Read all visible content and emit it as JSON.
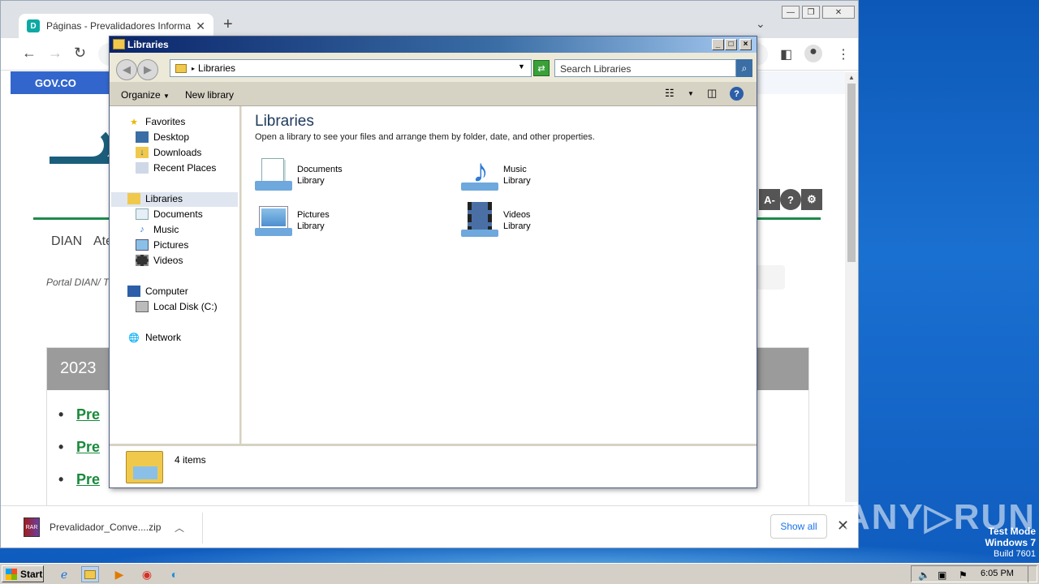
{
  "browser": {
    "tab_title": "Páginas - Prevalidadores Informació",
    "gov_label": "GOV.CO",
    "menu": [
      "DIAN",
      "Ate"
    ],
    "breadcrumb": "Portal DIAN/  T",
    "accessibility": [
      "A-",
      "?",
      "⚙"
    ],
    "panel_year": "2023",
    "bullets": [
      "Pre",
      "Pre",
      "Pre"
    ],
    "download": {
      "name": "Prevalidador_Conve....zip",
      "show_all": "Show all"
    }
  },
  "explorer": {
    "title": "Libraries",
    "address": "Libraries",
    "search_placeholder": "Search Libraries",
    "commands": {
      "organize": "Organize",
      "new_library": "New library"
    },
    "nav": {
      "favorites": "Favorites",
      "favorites_items": [
        "Desktop",
        "Downloads",
        "Recent Places"
      ],
      "libraries": "Libraries",
      "libraries_items": [
        "Documents",
        "Music",
        "Pictures",
        "Videos"
      ],
      "computer": "Computer",
      "computer_items": [
        "Local Disk (C:)"
      ],
      "network": "Network"
    },
    "heading": "Libraries",
    "description": "Open a library to see your files and arrange them by folder, date, and other properties.",
    "libs": [
      {
        "name": "Documents",
        "sub": "Library"
      },
      {
        "name": "Music",
        "sub": "Library"
      },
      {
        "name": "Pictures",
        "sub": "Library"
      },
      {
        "name": "Videos",
        "sub": "Library"
      }
    ],
    "status": "4 items"
  },
  "watermark": {
    "brand": "ANY▷RUN",
    "line1": "Test Mode",
    "line2": "Windows 7",
    "line3": "Build 7601"
  },
  "taskbar": {
    "start": "Start",
    "clock": "6:05 PM"
  }
}
